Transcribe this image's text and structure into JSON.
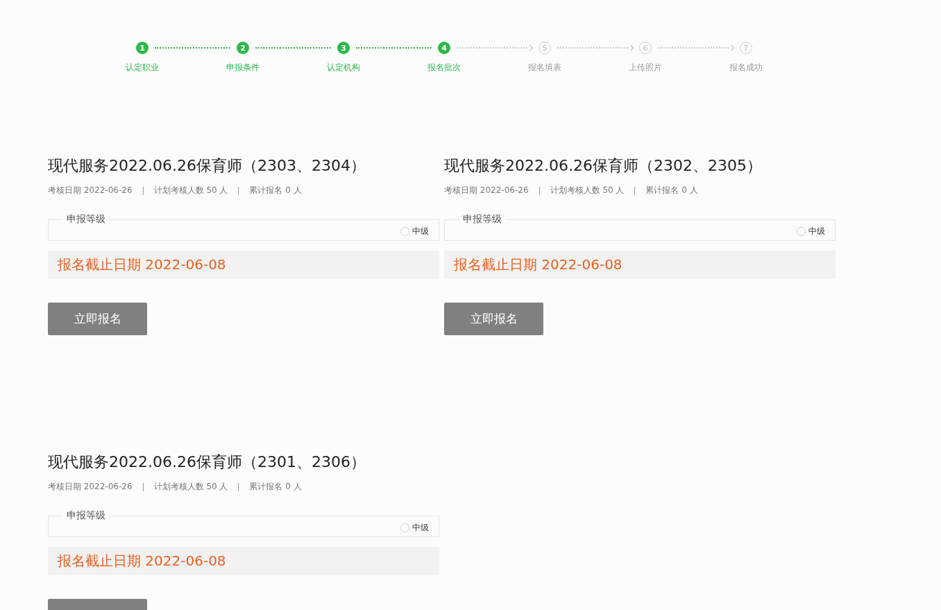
{
  "steps": [
    {
      "number": "1",
      "label": "认定职业",
      "done": true
    },
    {
      "number": "2",
      "label": "申报条件",
      "done": true
    },
    {
      "number": "3",
      "label": "认定机构",
      "done": true
    },
    {
      "number": "4",
      "label": "报名批次",
      "done": true
    },
    {
      "number": "5",
      "label": "报名填表",
      "done": false
    },
    {
      "number": "6",
      "label": "上传照片",
      "done": false
    },
    {
      "number": "7",
      "label": "报名成功",
      "done": false
    }
  ],
  "batches": [
    {
      "title": "现代服务2022.06.26保育师（2303、2304）",
      "meta": [
        "考核日期 2022-06-26",
        "计划考核人数 50 人",
        "累计报名 0 人"
      ],
      "level_legend": "申报等级",
      "levels": [
        {
          "label": "中级",
          "checked": false
        }
      ],
      "deadline": "报名截止日期 2022-06-08",
      "button": "立即报名"
    },
    {
      "title": "现代服务2022.06.26保育师（2302、2305）",
      "meta": [
        "考核日期 2022-06-26",
        "计划考核人数 50 人",
        "累计报名 0 人"
      ],
      "level_legend": "申报等级",
      "levels": [
        {
          "label": "中级",
          "checked": false
        }
      ],
      "deadline": "报名截止日期 2022-06-08",
      "button": "立即报名"
    },
    {
      "title": "现代服务2022.06.26保育师（2301、2306）",
      "meta": [
        "考核日期 2022-06-26",
        "计划考核人数 50 人",
        "累计报名 0 人"
      ],
      "level_legend": "申报等级",
      "levels": [
        {
          "label": "中级",
          "checked": false
        }
      ],
      "deadline": "报名截止日期 2022-06-08"
    }
  ]
}
